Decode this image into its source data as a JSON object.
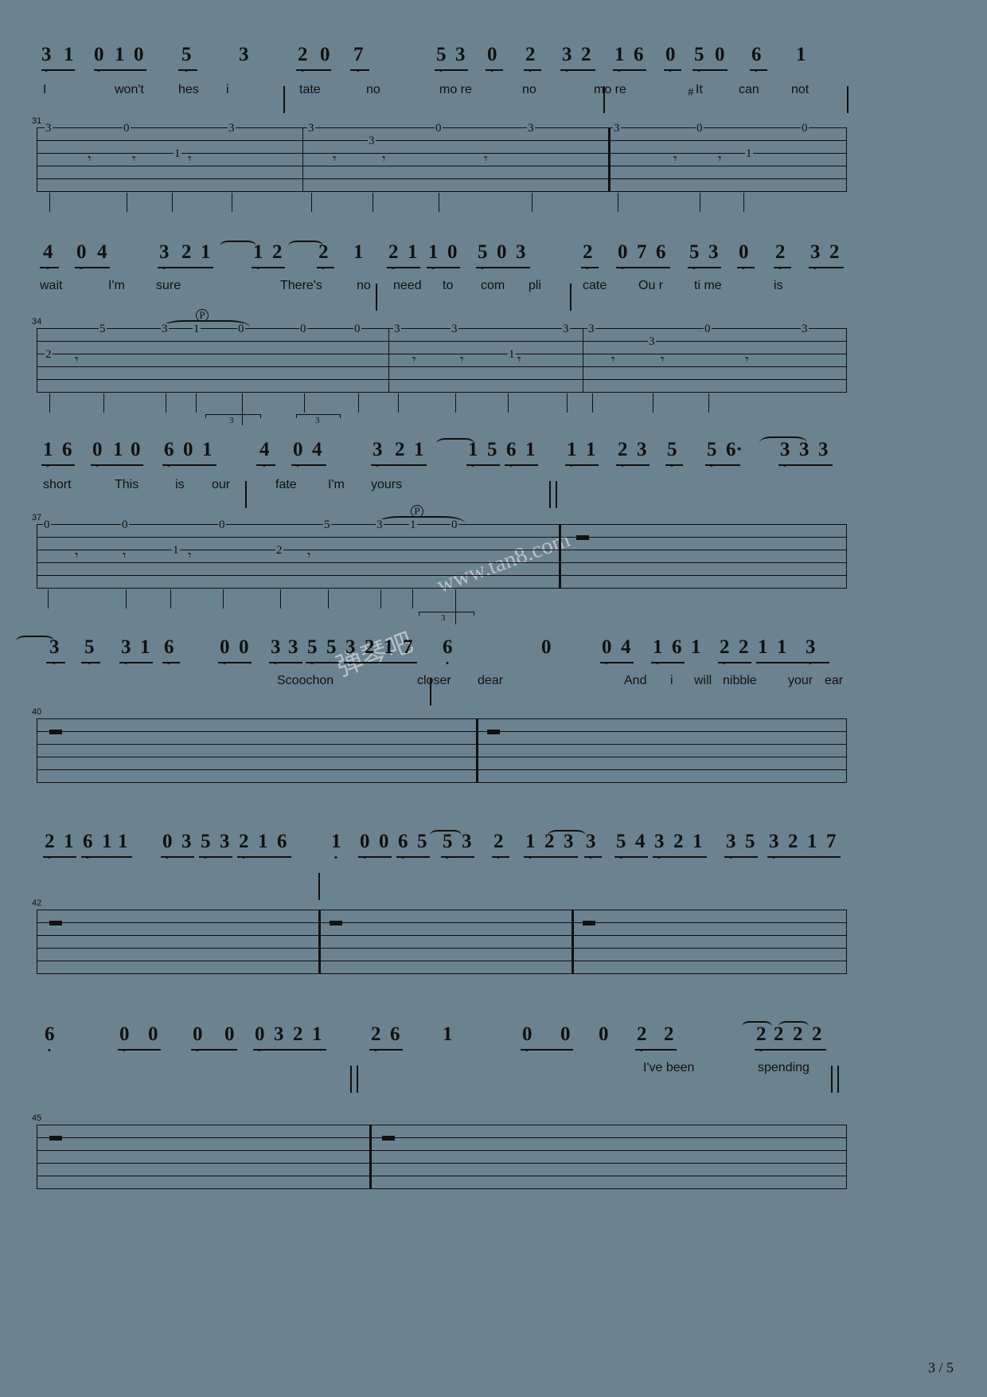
{
  "document": {
    "kind": "guitar-tab-sheet-music",
    "page_label": "3 / 5",
    "watermark_cn": "弹琴吧",
    "watermark_url": "www.tan8.com",
    "background_color": "#6b8290",
    "ink_color": "#111111"
  },
  "systems": [
    {
      "id": "system-1",
      "measure_number": "31",
      "numeric_notes": "3 1  0 1 0   5    3    | 2   0   7     5 3  0   2   3 2 | 1 6  0 #5 0   6    1",
      "lyrics": [
        "I",
        "won't",
        "hes",
        "i",
        "tate",
        "no",
        "mo re",
        "no",
        "mo re",
        "It",
        "can",
        "not"
      ],
      "tab_numbers": [
        "3",
        "0",
        "1",
        "3",
        "3",
        "3",
        "0",
        "3",
        "3",
        "3",
        "1",
        "0"
      ]
    },
    {
      "id": "system-2",
      "measure_number": "34",
      "numeric_notes": "4  0 4    3 2 1   1 2   2   1 | 2 1 1 0  5 0 3   | 2  0 7 6   5 3  0  2   3 2",
      "lyrics": [
        "wait",
        "I'm",
        "sure",
        "There's",
        "no",
        "need",
        "to",
        "com",
        "pli",
        "cate",
        "Ou r",
        "ti me",
        "is"
      ],
      "tab_numbers": [
        "2",
        "5",
        "3",
        "1",
        "0",
        "0",
        "0",
        "3",
        "0",
        "1",
        "3",
        "3",
        "0",
        "3"
      ],
      "tuplets": [
        "3",
        "3"
      ],
      "palm_mute": "P"
    },
    {
      "id": "system-3",
      "measure_number": "37",
      "numeric_notes": "1 6  0 1 0  6 0 1  | 4  0 4    3 2 1   1 5  6 1 ‖ 1 1  2 3 5   5 6·   3 3 3",
      "lyrics": [
        "short",
        "This",
        "is",
        "our",
        "fate",
        "I'm",
        "yours"
      ],
      "tab_numbers": [
        "0",
        "0",
        "1",
        "0",
        "5",
        "3",
        "1",
        "0"
      ],
      "palm_mute": "P",
      "tuplets": [
        "3"
      ]
    },
    {
      "id": "system-4",
      "measure_number": "40",
      "numeric_notes": "3  5 3 1 6   0 0  3 3 5 5 3 2 1 7 | 6    0    0 4  1 6 1 2 2 1 1 3",
      "lyrics": [
        "Scoochon",
        "closer",
        "dear",
        "And",
        "i",
        "will",
        "nibble",
        "your",
        "ear"
      ],
      "tab_numbers": []
    },
    {
      "id": "system-5",
      "measure_number": "42",
      "numeric_notes": "2 1 6 1 1   0 3 5 3 2 1 6 | 1 0 0 6 5  5 3   2 1 2 3   3  5 4 3 2 1   3 5 3 2 1 7",
      "lyrics": [],
      "tab_numbers": []
    },
    {
      "id": "system-6",
      "measure_number": "45",
      "numeric_notes": "6     0 0    0   0  0 3 2 1 ‖ 2 6    1     0   0  0   2 2     2 2 2 2 ‖",
      "lyrics": [
        "I've been",
        "spending"
      ],
      "tab_numbers": []
    }
  ]
}
